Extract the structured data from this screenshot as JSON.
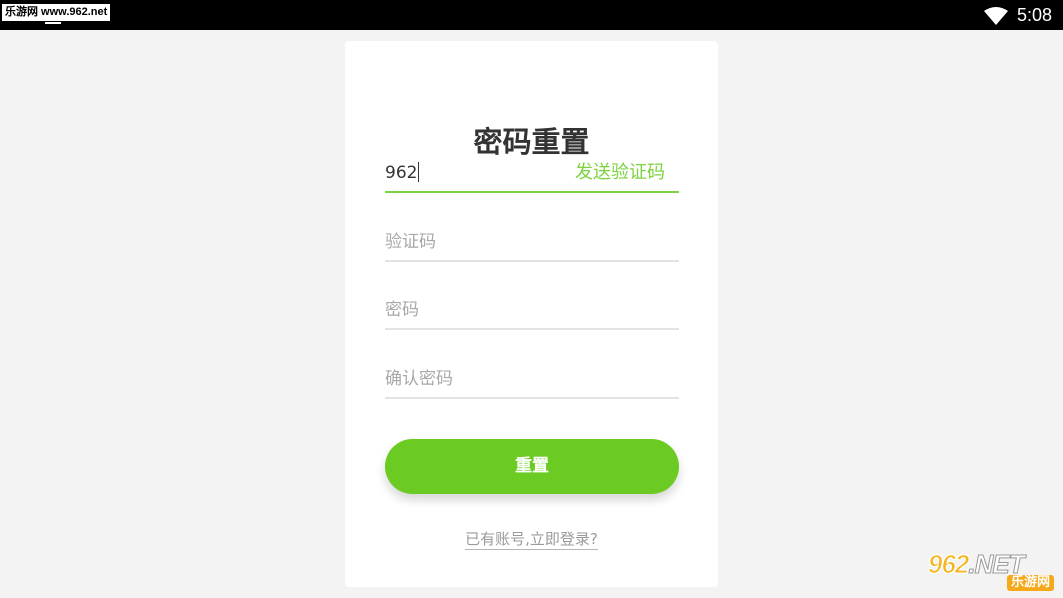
{
  "status_bar": {
    "watermark_text": "乐游网 www.962.net",
    "time": "5:08"
  },
  "form": {
    "title": "密码重置",
    "phone": {
      "value": "962",
      "send_code_label": "发送验证码"
    },
    "code_field": {
      "placeholder": "验证码"
    },
    "password_field": {
      "placeholder": "密码"
    },
    "confirm_field": {
      "placeholder": "确认密码"
    },
    "reset_button": "重置",
    "login_link": "已有账号,立即登录?"
  },
  "watermark": {
    "main": "962",
    "suffix": ".NET",
    "sub": "乐游网"
  },
  "colors": {
    "accent": "#6bcb22",
    "accent_light": "#7dd23f",
    "status_bar": "#000000",
    "background": "#f3f3f3"
  }
}
